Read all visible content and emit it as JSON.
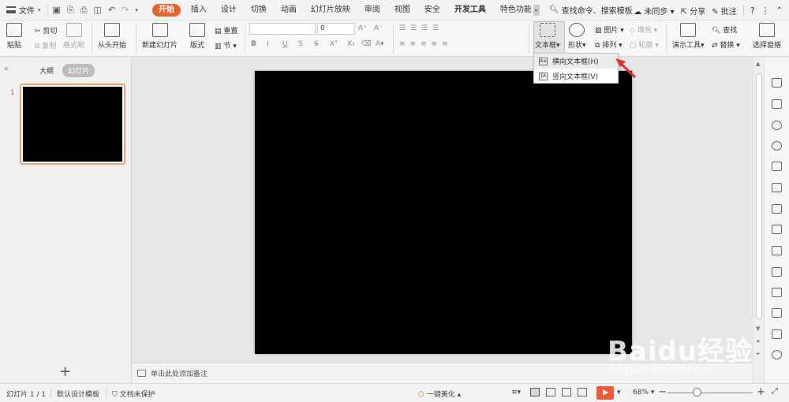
{
  "menubar": {
    "file_label": "文件",
    "tabs": [
      "开始",
      "插入",
      "设计",
      "切换",
      "动画",
      "幻灯片放映",
      "审阅",
      "视图",
      "安全",
      "开发工具",
      "特色功能"
    ],
    "active_tab": "开始",
    "search_label": "查找命令、搜索模板",
    "sync_label": "未同步",
    "share_label": "分享",
    "comment_label": "批注"
  },
  "ribbon": {
    "paste": "粘贴",
    "cut": "剪切",
    "copy": "复制",
    "format_painter": "格式刷",
    "from_start": "从头开始",
    "new_slide": "新建幻灯片",
    "layout": "版式",
    "reset": "重置",
    "section": "节",
    "font_size": "0",
    "text_box": "文本框",
    "shape": "形状",
    "picture": "图片",
    "fill": "填充",
    "arrange": "排列",
    "outline": "轮廓",
    "present_tools": "演示工具",
    "find": "查找",
    "replace": "替换",
    "select_pane": "选择窗格"
  },
  "dropdown": {
    "items": [
      "横向文本框(H)",
      "竖向文本框(V)"
    ]
  },
  "left_panel": {
    "outline_tab": "大纲",
    "slides_tab": "幻灯片",
    "slide_number": "1"
  },
  "notes": {
    "placeholder": "单击此处添加备注"
  },
  "statusbar": {
    "slide_info": "幻灯片 1 / 1",
    "template": "默认设计模板",
    "protection": "文档未保护",
    "beautify": "一键美化",
    "zoom": "68%"
  },
  "watermark": {
    "brand": "Baidu经验",
    "url": "jingyan.baidu.com"
  },
  "colors": {
    "accent": "#e8642c",
    "play": "#ef5a3a",
    "slide_bg": "#000000"
  }
}
